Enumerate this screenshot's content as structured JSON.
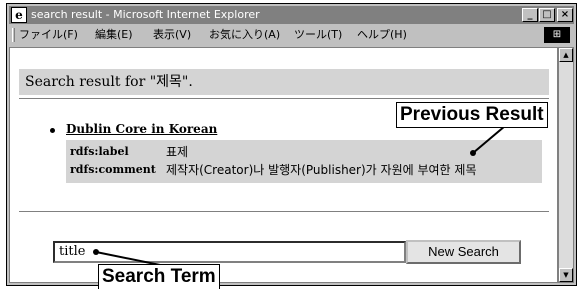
{
  "window": {
    "title": "search result - Microsoft Internet Explorer",
    "icon": "ie-logo-icon",
    "controls": {
      "minimize": "_",
      "maximize": "□",
      "close": "×"
    }
  },
  "menubar": {
    "items": [
      "ファイル(F)",
      "編集(E)",
      "表示(V)",
      "お気に入り(A)",
      "ツール(T)",
      "ヘルプ(H)"
    ]
  },
  "page": {
    "result_header": "Search result for \"제목\".",
    "result": {
      "link": "Dublin Core in Korean",
      "properties": [
        {
          "label": "rdfs:label",
          "value": "표제"
        },
        {
          "label": "rdfs:comment",
          "value": "제작자(Creator)나 발행자(Publisher)가 자원에 부여한 제목"
        }
      ]
    },
    "search": {
      "value": "title",
      "button": "New Search"
    }
  },
  "annotations": {
    "previous_result": "Previous Result",
    "search_term": "Search Term"
  },
  "colors": {
    "highlight_band": "#d4d4d4",
    "titlebar_inactive": "#808080"
  }
}
